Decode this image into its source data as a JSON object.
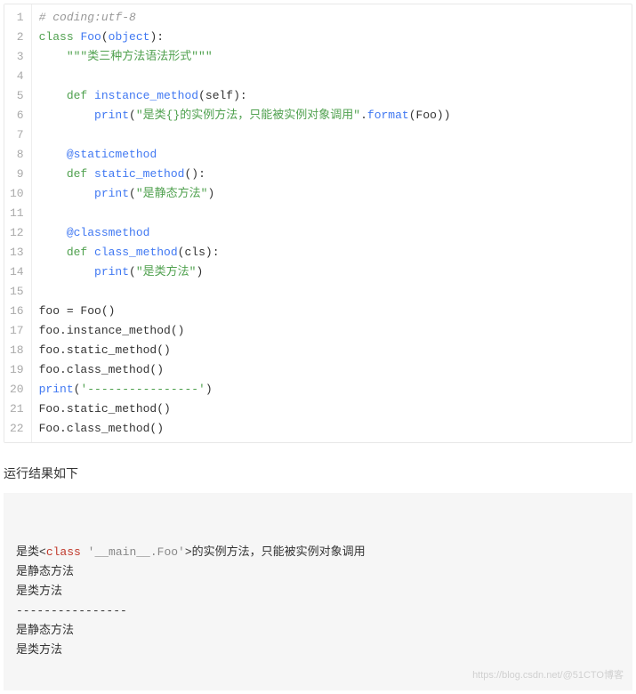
{
  "code": {
    "lines": [
      {
        "n": "1",
        "tokens": [
          {
            "t": "# coding:utf-8",
            "c": "cm"
          }
        ]
      },
      {
        "n": "2",
        "tokens": [
          {
            "t": "class",
            "c": "kgreen"
          },
          {
            "t": " "
          },
          {
            "t": "Foo",
            "c": "fn"
          },
          {
            "t": "("
          },
          {
            "t": "object",
            "c": "bi"
          },
          {
            "t": "):"
          }
        ]
      },
      {
        "n": "3",
        "tokens": [
          {
            "t": "    "
          },
          {
            "t": "\"\"\"类三种方法语法形式\"\"\"",
            "c": "st"
          }
        ]
      },
      {
        "n": "4",
        "tokens": []
      },
      {
        "n": "5",
        "tokens": [
          {
            "t": "    "
          },
          {
            "t": "def",
            "c": "kgreen"
          },
          {
            "t": " "
          },
          {
            "t": "instance_method",
            "c": "fn"
          },
          {
            "t": "("
          },
          {
            "t": "self",
            "c": ""
          },
          {
            "t": "):"
          }
        ]
      },
      {
        "n": "6",
        "tokens": [
          {
            "t": "        "
          },
          {
            "t": "print",
            "c": "bi"
          },
          {
            "t": "("
          },
          {
            "t": "\"是类{}的实例方法，只能被实例对象调用\"",
            "c": "st"
          },
          {
            "t": "."
          },
          {
            "t": "format",
            "c": "bi"
          },
          {
            "t": "("
          },
          {
            "t": "Foo"
          },
          {
            "t": "))"
          }
        ]
      },
      {
        "n": "7",
        "tokens": []
      },
      {
        "n": "8",
        "tokens": [
          {
            "t": "    "
          },
          {
            "t": "@staticmethod",
            "c": "dec"
          }
        ]
      },
      {
        "n": "9",
        "tokens": [
          {
            "t": "    "
          },
          {
            "t": "def",
            "c": "kgreen"
          },
          {
            "t": " "
          },
          {
            "t": "static_method",
            "c": "fn"
          },
          {
            "t": "():"
          }
        ]
      },
      {
        "n": "10",
        "tokens": [
          {
            "t": "        "
          },
          {
            "t": "print",
            "c": "bi"
          },
          {
            "t": "("
          },
          {
            "t": "\"是静态方法\"",
            "c": "st"
          },
          {
            "t": ")"
          }
        ]
      },
      {
        "n": "11",
        "tokens": []
      },
      {
        "n": "12",
        "tokens": [
          {
            "t": "    "
          },
          {
            "t": "@classmethod",
            "c": "dec"
          }
        ]
      },
      {
        "n": "13",
        "tokens": [
          {
            "t": "    "
          },
          {
            "t": "def",
            "c": "kgreen"
          },
          {
            "t": " "
          },
          {
            "t": "class_method",
            "c": "fn"
          },
          {
            "t": "("
          },
          {
            "t": "cls"
          },
          {
            "t": "):"
          }
        ]
      },
      {
        "n": "14",
        "tokens": [
          {
            "t": "        "
          },
          {
            "t": "print",
            "c": "bi"
          },
          {
            "t": "("
          },
          {
            "t": "\"是类方法\"",
            "c": "st"
          },
          {
            "t": ")"
          }
        ]
      },
      {
        "n": "15",
        "tokens": []
      },
      {
        "n": "16",
        "tokens": [
          {
            "t": "foo = Foo()"
          }
        ]
      },
      {
        "n": "17",
        "tokens": [
          {
            "t": "foo.instance_method()"
          }
        ]
      },
      {
        "n": "18",
        "tokens": [
          {
            "t": "foo.static_method()"
          }
        ]
      },
      {
        "n": "19",
        "tokens": [
          {
            "t": "foo.class_method()"
          }
        ]
      },
      {
        "n": "20",
        "tokens": [
          {
            "t": "print",
            "c": "bi"
          },
          {
            "t": "("
          },
          {
            "t": "'----------------'",
            "c": "st"
          },
          {
            "t": ")"
          }
        ]
      },
      {
        "n": "21",
        "tokens": [
          {
            "t": "Foo.static_method()"
          }
        ]
      },
      {
        "n": "22",
        "tokens": [
          {
            "t": "Foo.class_method()"
          }
        ]
      }
    ]
  },
  "section_label": "运行结果如下",
  "output": {
    "lines": [
      [
        {
          "t": "是类<"
        },
        {
          "t": "class",
          "c": "out-cls"
        },
        {
          "t": " "
        },
        {
          "t": "'__main__.Foo'",
          "c": "out-str"
        },
        {
          "t": ">的实例方法，只能被实例对象调用"
        }
      ],
      [
        {
          "t": "是静态方法"
        }
      ],
      [
        {
          "t": "是类方法"
        }
      ],
      [
        {
          "t": "----------------"
        }
      ],
      [
        {
          "t": "是静态方法"
        }
      ],
      [
        {
          "t": "是类方法"
        }
      ]
    ]
  },
  "watermark": "https://blog.csdn.net/@51CTO博客"
}
